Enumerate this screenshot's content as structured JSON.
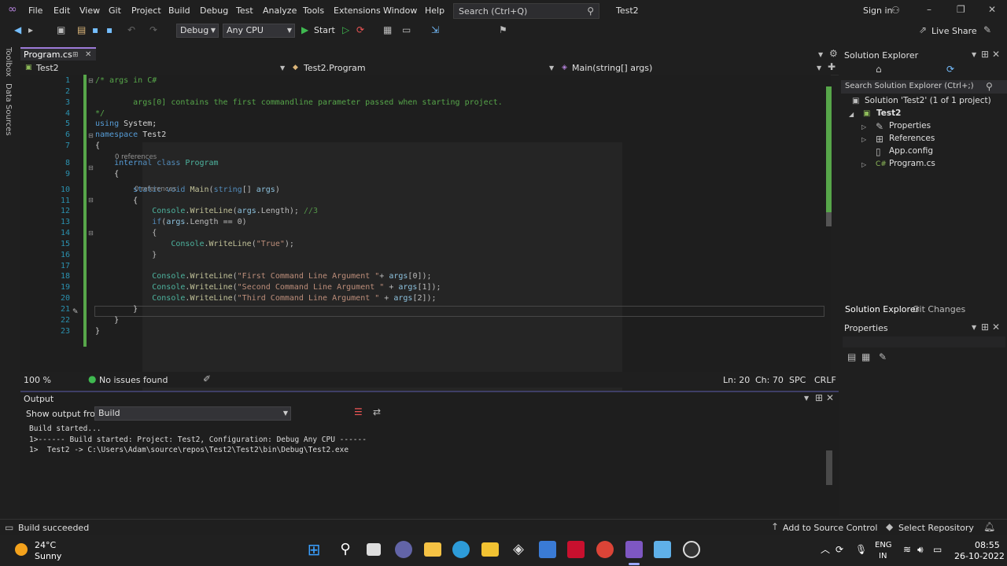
{
  "menu": [
    "File",
    "Edit",
    "View",
    "Git",
    "Project",
    "Build",
    "Debug",
    "Test",
    "Analyze",
    "Tools",
    "Extensions",
    "Window",
    "Help"
  ],
  "search": {
    "placeholder": "Search (Ctrl+Q)"
  },
  "solution_name": "Test2",
  "signin": "Sign in",
  "toolbar": {
    "config": "Debug",
    "platform": "Any CPU",
    "start": "Start",
    "live_share": "Live Share"
  },
  "left_strip": [
    "Toolbox",
    "Data Sources"
  ],
  "doc_tab": "Program.cs",
  "navbar": {
    "project": "Test2",
    "type": "Test2.Program",
    "member": "Main(string[] args)"
  },
  "code_lines": [
    {
      "n": "1",
      "parts": [
        {
          "c": "green",
          "t": "/* args in C#"
        }
      ]
    },
    {
      "n": "2",
      "parts": []
    },
    {
      "n": "3",
      "parts": [
        {
          "c": "green",
          "t": "        args[0] contains the first commandline parameter passed when starting project."
        }
      ]
    },
    {
      "n": "4",
      "parts": [
        {
          "c": "green",
          "t": "*/"
        }
      ]
    },
    {
      "n": "5",
      "parts": [
        {
          "c": "blue",
          "t": "using"
        },
        {
          "c": "",
          "t": " System;"
        }
      ]
    },
    {
      "n": "6",
      "parts": [
        {
          "c": "blue",
          "t": "namespace"
        },
        {
          "c": "",
          "t": " Test2"
        }
      ]
    },
    {
      "n": "7",
      "parts": [
        {
          "c": "",
          "t": "{"
        }
      ]
    },
    {
      "n": "8",
      "parts": [
        {
          "c": "",
          "t": "    "
        },
        {
          "c": "blue",
          "t": "internal class"
        },
        {
          "c": "",
          "t": " "
        },
        {
          "c": "teal",
          "t": "Program"
        }
      ]
    },
    {
      "n": "9",
      "parts": [
        {
          "c": "",
          "t": "    {"
        }
      ]
    },
    {
      "n": "10",
      "parts": [
        {
          "c": "",
          "t": "        "
        },
        {
          "c": "blue",
          "t": "static void"
        },
        {
          "c": "",
          "t": " "
        },
        {
          "c": "yel",
          "t": "Main"
        },
        {
          "c": "",
          "t": "("
        },
        {
          "c": "blue",
          "t": "string"
        },
        {
          "c": "",
          "t": "[] "
        },
        {
          "c": "var",
          "t": "args"
        },
        {
          "c": "",
          "t": ")"
        }
      ]
    },
    {
      "n": "11",
      "parts": [
        {
          "c": "",
          "t": "        {"
        }
      ]
    },
    {
      "n": "12",
      "parts": [
        {
          "c": "",
          "t": "            "
        },
        {
          "c": "teal",
          "t": "Console"
        },
        {
          "c": "",
          "t": "."
        },
        {
          "c": "yel",
          "t": "WriteLine"
        },
        {
          "c": "",
          "t": "("
        },
        {
          "c": "var",
          "t": "args"
        },
        {
          "c": "",
          "t": ".Length); "
        },
        {
          "c": "green",
          "t": "//3"
        }
      ]
    },
    {
      "n": "13",
      "parts": [
        {
          "c": "",
          "t": "            "
        },
        {
          "c": "blue",
          "t": "if"
        },
        {
          "c": "",
          "t": "("
        },
        {
          "c": "var",
          "t": "args"
        },
        {
          "c": "",
          "t": ".Length == 0)"
        }
      ]
    },
    {
      "n": "14",
      "parts": [
        {
          "c": "",
          "t": "            {"
        }
      ]
    },
    {
      "n": "15",
      "parts": [
        {
          "c": "",
          "t": "                "
        },
        {
          "c": "teal",
          "t": "Console"
        },
        {
          "c": "",
          "t": "."
        },
        {
          "c": "yel",
          "t": "WriteLine"
        },
        {
          "c": "",
          "t": "("
        },
        {
          "c": "str",
          "t": "\"True\""
        },
        {
          "c": "",
          "t": ");"
        }
      ]
    },
    {
      "n": "16",
      "parts": [
        {
          "c": "",
          "t": "            }"
        }
      ]
    },
    {
      "n": "17",
      "parts": []
    },
    {
      "n": "18",
      "parts": [
        {
          "c": "",
          "t": "            "
        },
        {
          "c": "teal",
          "t": "Console"
        },
        {
          "c": "",
          "t": "."
        },
        {
          "c": "yel",
          "t": "WriteLine"
        },
        {
          "c": "",
          "t": "("
        },
        {
          "c": "str",
          "t": "\"First Command Line Argument \""
        },
        {
          "c": "",
          "t": "+ "
        },
        {
          "c": "var",
          "t": "args"
        },
        {
          "c": "",
          "t": "[0]);"
        }
      ]
    },
    {
      "n": "19",
      "parts": [
        {
          "c": "",
          "t": "            "
        },
        {
          "c": "teal",
          "t": "Console"
        },
        {
          "c": "",
          "t": "."
        },
        {
          "c": "yel",
          "t": "WriteLine"
        },
        {
          "c": "",
          "t": "("
        },
        {
          "c": "str",
          "t": "\"Second Command Line Argument \""
        },
        {
          "c": "",
          "t": " + "
        },
        {
          "c": "var",
          "t": "args"
        },
        {
          "c": "",
          "t": "[1]);"
        }
      ]
    },
    {
      "n": "20",
      "parts": [
        {
          "c": "",
          "t": "            "
        },
        {
          "c": "teal",
          "t": "Console"
        },
        {
          "c": "",
          "t": "."
        },
        {
          "c": "yel",
          "t": "WriteLine"
        },
        {
          "c": "",
          "t": "("
        },
        {
          "c": "str",
          "t": "\"Third Command Line Argument \""
        },
        {
          "c": "",
          "t": " + "
        },
        {
          "c": "var",
          "t": "args"
        },
        {
          "c": "",
          "t": "[2]);"
        }
      ]
    },
    {
      "n": "21",
      "parts": [
        {
          "c": "",
          "t": "        }"
        }
      ]
    },
    {
      "n": "22",
      "parts": [
        {
          "c": "",
          "t": "    }"
        }
      ]
    },
    {
      "n": "23",
      "parts": [
        {
          "c": "",
          "t": "}"
        }
      ]
    }
  ],
  "codelens": [
    "0 references",
    "0 references"
  ],
  "editor_status": {
    "zoom": "100 %",
    "issues": "No issues found",
    "ln": "Ln: 20",
    "ch": "Ch: 70",
    "spc": "SPC",
    "crlf": "CRLF"
  },
  "output": {
    "title": "Output",
    "show_from_label": "Show output from:",
    "source": "Build",
    "lines": [
      "Build started...",
      "1>------ Build started: Project: Test2, Configuration: Debug Any CPU ------",
      "1>  Test2 -> C:\\Users\\Adam\\source\\repos\\Test2\\Test2\\bin\\Debug\\Test2.exe"
    ]
  },
  "solution_explorer": {
    "title": "Solution Explorer",
    "search_placeholder": "Search Solution Explorer (Ctrl+;)",
    "solution": "Solution 'Test2' (1 of 1 project)",
    "project": "Test2",
    "items": [
      "Properties",
      "References",
      "App.config",
      "Program.cs"
    ],
    "tabs": [
      "Solution Explorer",
      "Git Changes"
    ]
  },
  "properties": {
    "title": "Properties"
  },
  "statusbar": {
    "message": "Build succeeded",
    "source_control": "Add to Source Control",
    "repo": "Select Repository"
  },
  "taskbar": {
    "temp": "24°C",
    "weather": "Sunny",
    "lang1": "ENG",
    "lang2": "IN",
    "time": "08:55",
    "date": "26-10-2022"
  },
  "colors": {
    "accent": "#9d7ad8",
    "code_green": "#57a64a",
    "keyword_blue": "#569cd6",
    "type_teal": "#4ec9b0"
  }
}
